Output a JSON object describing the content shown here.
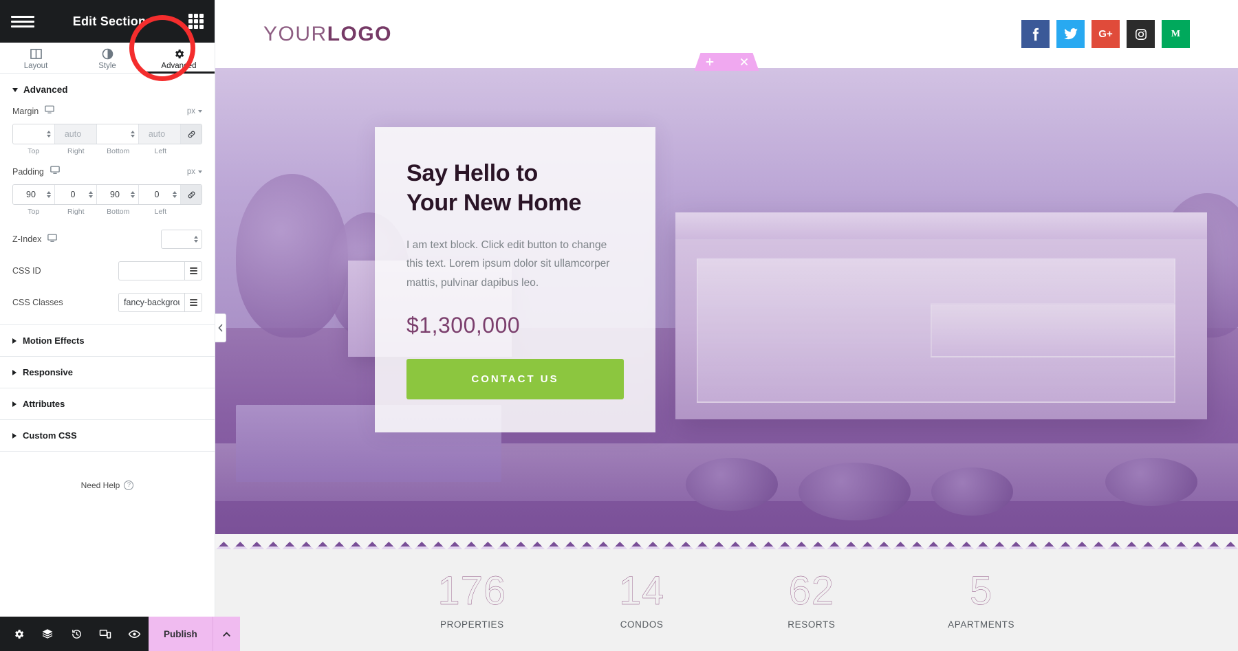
{
  "panel": {
    "header": {
      "title": "Edit Section",
      "menu_icon": "hamburger-menu-icon",
      "grid_icon": "apps-grid-icon"
    },
    "tabs": [
      {
        "label": "Layout",
        "icon": "layout-columns-icon",
        "active": false
      },
      {
        "label": "Style",
        "icon": "contrast-circle-icon",
        "active": false
      },
      {
        "label": "Advanced",
        "icon": "gear-icon",
        "active": true
      }
    ],
    "section_title": "Advanced",
    "margin": {
      "label": "Margin",
      "unit": "px",
      "device_icon": "desktop-icon",
      "values": [
        "",
        "",
        "",
        ""
      ],
      "placeholders": [
        "",
        "auto",
        "",
        "auto"
      ],
      "captions": [
        "Top",
        "Right",
        "Bottom",
        "Left"
      ],
      "link_icon": "link-icon"
    },
    "padding": {
      "label": "Padding",
      "unit": "px",
      "device_icon": "desktop-icon",
      "values": [
        "90",
        "0",
        "90",
        "0"
      ],
      "placeholders": [
        "",
        "",
        "",
        ""
      ],
      "captions": [
        "Top",
        "Right",
        "Bottom",
        "Left"
      ],
      "link_icon": "link-icon"
    },
    "z_index": {
      "label": "Z-Index",
      "value": "",
      "device_icon": "desktop-icon"
    },
    "css_id": {
      "label": "CSS ID",
      "value": "",
      "dynamic_icon": "dynamic-tags-icon"
    },
    "css_classes": {
      "label": "CSS Classes",
      "value": "fancy-backgroun",
      "dynamic_icon": "dynamic-tags-icon"
    },
    "accordion": [
      {
        "label": "Motion Effects"
      },
      {
        "label": "Responsive"
      },
      {
        "label": "Attributes"
      },
      {
        "label": "Custom CSS"
      }
    ],
    "need_help": {
      "label": "Need Help",
      "icon": "question-circle-icon"
    },
    "footer": {
      "icons": [
        {
          "name": "settings-gear-icon"
        },
        {
          "name": "layers-navigator-icon"
        },
        {
          "name": "history-revisions-icon"
        },
        {
          "name": "responsive-mode-icon"
        },
        {
          "name": "preview-eye-icon"
        }
      ],
      "publish_label": "Publish",
      "publish_caret_icon": "chevron-up-icon",
      "publish_color": "#f0bbf0"
    },
    "collapse_icon": "chevron-left-icon",
    "highlight_color": "#f42d2d"
  },
  "canvas": {
    "site_header": {
      "logo_thin": "YOUR",
      "logo_bold": "LOGO",
      "logo_color": "#7b3f6d",
      "socials": [
        {
          "name": "facebook-icon",
          "glyph": "f",
          "color": "#3b5998"
        },
        {
          "name": "twitter-icon",
          "glyph": "t",
          "color": "#28a9f1"
        },
        {
          "name": "google-plus-icon",
          "glyph": "G+",
          "color": "#e04b3a"
        },
        {
          "name": "instagram-icon",
          "glyph": "ig",
          "color": "#2b2b2b"
        },
        {
          "name": "medium-icon",
          "glyph": "M",
          "color": "#00a95c"
        }
      ]
    },
    "section_toolbar": {
      "add_icon": "plus-icon",
      "drag_icon": "drag-handle-dots-icon",
      "close_icon": "close-x-icon",
      "color": "#f0a8f0"
    },
    "hero": {
      "heading_line1": "Say Hello to",
      "heading_line2": "Your New Home",
      "paragraph": "I am text block. Click edit button to change this text. Lorem ipsum dolor sit ullamcorper mattis, pulvinar dapibus leo.",
      "price": "$1,300,000",
      "cta_label": "CONTACT US",
      "cta_color": "#8cc63f"
    },
    "stats": [
      {
        "number": "176",
        "label": "PROPERTIES"
      },
      {
        "number": "14",
        "label": "CONDOS"
      },
      {
        "number": "62",
        "label": "RESORTS"
      },
      {
        "number": "5",
        "label": "APARTMENTS"
      }
    ]
  }
}
